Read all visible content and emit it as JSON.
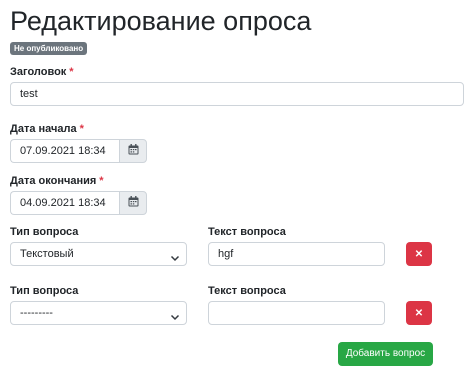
{
  "header": {
    "title": "Редактирование опроса",
    "status_badge": "Не опубликовано"
  },
  "form": {
    "title_label": "Заголовок",
    "title_value": "test",
    "start_label": "Дата начала",
    "start_value": "07.09.2021 18:34",
    "end_label": "Дата окончания",
    "end_value": "04.09.2021 18:34",
    "required_mark": "*"
  },
  "questions": [
    {
      "type_label": "Тип вопроса",
      "type_value": "Текстовый",
      "text_label": "Текст вопроса",
      "text_value": "hgf",
      "delete_glyph": "✕"
    },
    {
      "type_label": "Тип вопроса",
      "type_value": "---------",
      "text_label": "Текст вопроса",
      "text_value": "",
      "delete_glyph": "✕"
    }
  ],
  "actions": {
    "add_question": "Добавить вопрос"
  },
  "icons": {
    "calendar": "calendar-icon",
    "chevron": "chevron-down-icon",
    "delete": "close-icon"
  },
  "colors": {
    "badge": "#6c757d",
    "required": "#dc3545",
    "delete_button": "#dc3545",
    "add_button": "#28a745"
  }
}
